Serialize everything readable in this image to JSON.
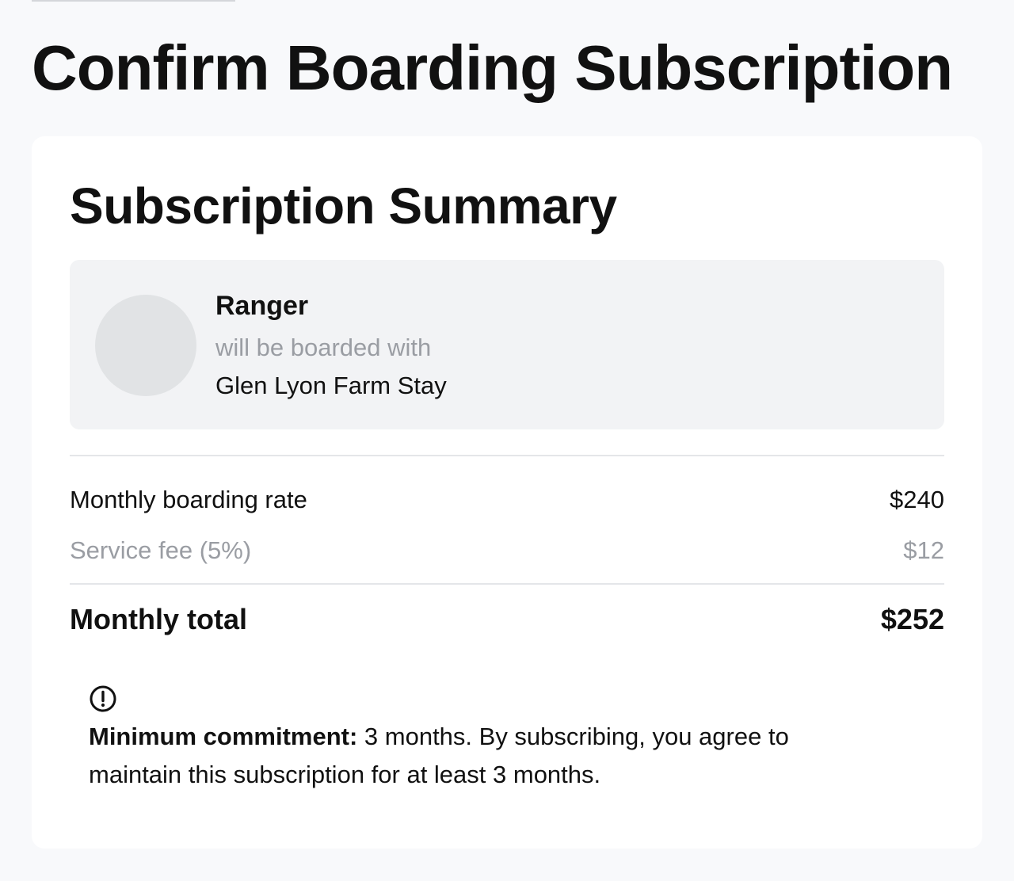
{
  "page": {
    "title": "Confirm Boarding Subscription"
  },
  "summary": {
    "title": "Subscription Summary",
    "pet": {
      "name": "Ranger",
      "subtitle": "will be boarded with",
      "provider": "Glen Lyon Farm Stay"
    },
    "rows": {
      "rate_label": "Monthly boarding rate",
      "rate_value": "$240",
      "fee_label": "Service fee (5%)",
      "fee_value": "$12",
      "total_label": "Monthly total",
      "total_value": "$252"
    },
    "notice": {
      "icon": "alert-circle-icon",
      "label": "Minimum commitment:",
      "text": " 3 months. By subscribing, you agree to maintain this subscription for at least 3 months."
    }
  },
  "colors": {
    "background": "#f8f9fb",
    "card": "#ffffff",
    "pet_box": "#f2f3f5",
    "avatar": "#e1e3e5",
    "muted_text": "#9a9da3",
    "text": "#111111",
    "divider": "#e4e6e9"
  }
}
